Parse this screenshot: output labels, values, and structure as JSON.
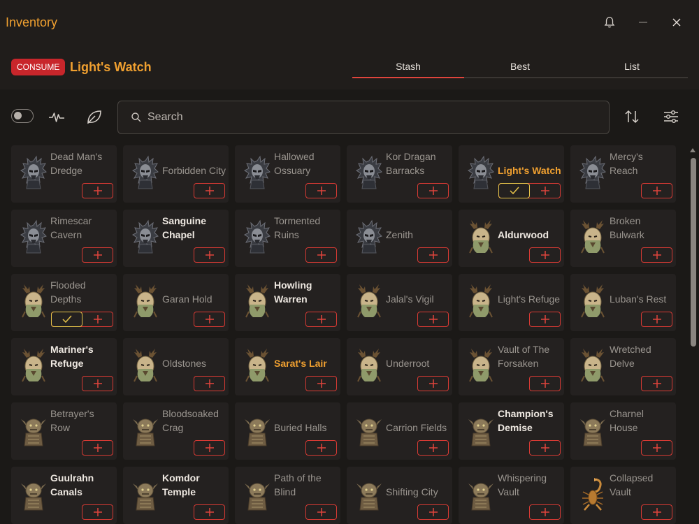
{
  "window": {
    "title": "Inventory"
  },
  "header": {
    "badge": "CONSUME",
    "item": "Light's Watch",
    "tabs": [
      {
        "label": "Stash",
        "active": true
      },
      {
        "label": "Best",
        "active": false
      },
      {
        "label": "List",
        "active": false
      }
    ]
  },
  "toolbar": {
    "search_placeholder": "Search"
  },
  "colors": {
    "accent": "#f0a030",
    "danger": "#d83a34",
    "badge": "#c8262b",
    "check": "#e6c34a"
  },
  "cards": [
    {
      "label": "Dead Man's Dredge",
      "style": "normal",
      "icon": "spiked-helmet-icon",
      "checked": false
    },
    {
      "label": "Forbidden City",
      "style": "normal",
      "icon": "spiked-helmet-icon",
      "checked": false
    },
    {
      "label": "Hallowed Ossuary",
      "style": "normal",
      "icon": "spiked-helmet-icon",
      "checked": false
    },
    {
      "label": "Kor Dragan Barracks",
      "style": "normal",
      "icon": "spiked-helmet-icon",
      "checked": false
    },
    {
      "label": "Light's Watch",
      "style": "highlight",
      "icon": "spiked-helmet-icon",
      "checked": true
    },
    {
      "label": "Mercy's Reach",
      "style": "normal",
      "icon": "spiked-helmet-icon",
      "checked": false
    },
    {
      "label": "Rimescar Cavern",
      "style": "normal",
      "icon": "spiked-helmet-icon",
      "checked": false
    },
    {
      "label": "Sanguine Chapel",
      "style": "bold",
      "icon": "spiked-helmet-icon",
      "checked": false
    },
    {
      "label": "Tormented Ruins",
      "style": "normal",
      "icon": "spiked-helmet-icon",
      "checked": false
    },
    {
      "label": "Zenith",
      "style": "normal",
      "icon": "spiked-helmet-icon",
      "checked": false
    },
    {
      "label": "Aldurwood",
      "style": "bold",
      "icon": "antler-beast-icon",
      "checked": false
    },
    {
      "label": "Broken Bulwark",
      "style": "normal",
      "icon": "antler-beast-icon",
      "checked": false
    },
    {
      "label": "Flooded Depths",
      "style": "normal",
      "icon": "antler-beast-icon",
      "checked": true
    },
    {
      "label": "Garan Hold",
      "style": "normal",
      "icon": "antler-beast-icon",
      "checked": false
    },
    {
      "label": "Howling Warren",
      "style": "bold",
      "icon": "antler-beast-icon",
      "checked": false
    },
    {
      "label": "Jalal's Vigil",
      "style": "normal",
      "icon": "antler-beast-icon",
      "checked": false
    },
    {
      "label": "Light's Refuge",
      "style": "normal",
      "icon": "antler-beast-icon",
      "checked": false
    },
    {
      "label": "Luban's Rest",
      "style": "normal",
      "icon": "antler-beast-icon",
      "checked": false
    },
    {
      "label": "Mariner's Refuge",
      "style": "bold",
      "icon": "antler-beast-icon",
      "checked": false
    },
    {
      "label": "Oldstones",
      "style": "normal",
      "icon": "antler-beast-icon",
      "checked": false
    },
    {
      "label": "Sarat's Lair",
      "style": "highlight",
      "icon": "antler-beast-icon",
      "checked": false
    },
    {
      "label": "Underroot",
      "style": "normal",
      "icon": "antler-beast-icon",
      "checked": false
    },
    {
      "label": "Vault of The Forsaken",
      "style": "normal",
      "icon": "antler-beast-icon",
      "checked": false
    },
    {
      "label": "Wretched Delve",
      "style": "normal",
      "icon": "antler-beast-icon",
      "checked": false
    },
    {
      "label": "Betrayer's Row",
      "style": "normal",
      "icon": "goblin-icon",
      "checked": false
    },
    {
      "label": "Bloodsoaked Crag",
      "style": "normal",
      "icon": "goblin-icon",
      "checked": false
    },
    {
      "label": "Buried Halls",
      "style": "normal",
      "icon": "goblin-icon",
      "checked": false
    },
    {
      "label": "Carrion Fields",
      "style": "normal",
      "icon": "goblin-icon",
      "checked": false
    },
    {
      "label": "Champion's Demise",
      "style": "bold",
      "icon": "goblin-icon",
      "checked": false
    },
    {
      "label": "Charnel House",
      "style": "normal",
      "icon": "goblin-icon",
      "checked": false
    },
    {
      "label": "Guulrahn Canals",
      "style": "bold",
      "icon": "goblin-icon",
      "checked": false
    },
    {
      "label": "Komdor Temple",
      "style": "bold",
      "icon": "goblin-icon",
      "checked": false
    },
    {
      "label": "Path of the Blind",
      "style": "normal",
      "icon": "goblin-icon",
      "checked": false
    },
    {
      "label": "Shifting City",
      "style": "normal",
      "icon": "goblin-icon",
      "checked": false
    },
    {
      "label": "Whispering Vault",
      "style": "normal",
      "icon": "goblin-icon",
      "checked": false
    },
    {
      "label": "Collapsed Vault",
      "style": "normal",
      "icon": "scorpion-icon",
      "checked": false
    }
  ]
}
